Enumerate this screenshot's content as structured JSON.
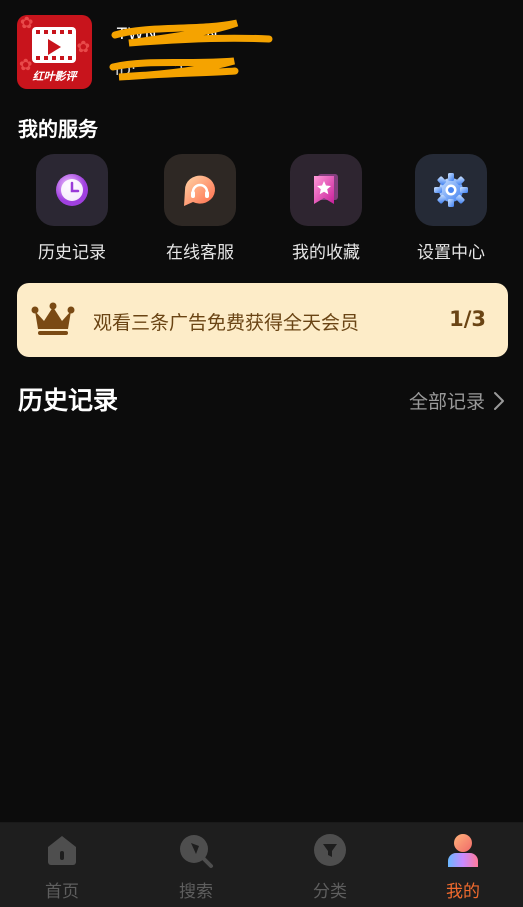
{
  "profile": {
    "logo_text": "红叶影评",
    "username": "TWN... ...IN",
    "user_id": "ID: ... ...2"
  },
  "services": {
    "title": "我的服务",
    "items": [
      {
        "label": "历史记录",
        "icon": "clock-icon"
      },
      {
        "label": "在线客服",
        "icon": "headset-icon"
      },
      {
        "label": "我的收藏",
        "icon": "bookmark-star-icon"
      },
      {
        "label": "设置中心",
        "icon": "gear-icon"
      }
    ]
  },
  "vip_banner": {
    "icon": "crown-icon",
    "text": "观看三条广告免费获得全天会员",
    "progress": "1/3"
  },
  "history": {
    "title": "历史记录",
    "all_label": "全部记录"
  },
  "tabbar": {
    "active": "我的",
    "items": [
      {
        "label": "首页",
        "icon": "home-icon"
      },
      {
        "label": "搜索",
        "icon": "search-icon"
      },
      {
        "label": "分类",
        "icon": "filter-icon"
      },
      {
        "label": "我的",
        "icon": "profile-icon"
      }
    ]
  },
  "colors": {
    "background": "#0c0c0c",
    "banner_bg": "#fdecc8",
    "banner_text": "#6a4414",
    "active_tab": "#f06a2e",
    "logo_red": "#c8141c",
    "redaction": "#f5a300"
  }
}
